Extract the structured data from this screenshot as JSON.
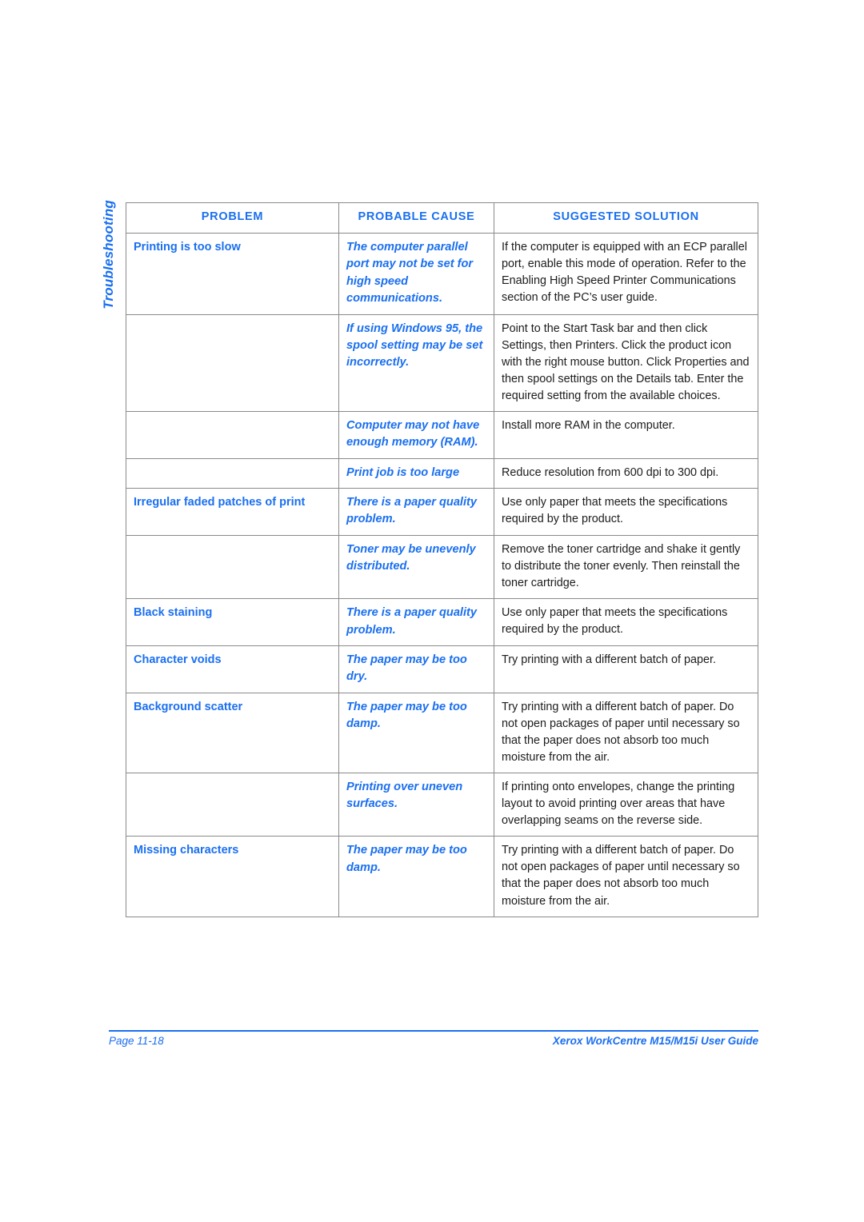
{
  "page": {
    "side_tab_label": "Troubleshooting",
    "accent_color": "#1a6ff0",
    "body_text_color": "#1c1c1c",
    "border_color": "#8a8a8a"
  },
  "table": {
    "headers": {
      "problem": "PROBLEM",
      "cause": "PROBABLE CAUSE",
      "solution": "SUGGESTED SOLUTION"
    },
    "rows": [
      {
        "problem": "Printing is too slow",
        "cause": "The computer parallel port may not be set for high speed communications.",
        "solution": "If the computer is equipped with an ECP parallel port, enable this mode of operation. Refer to the Enabling High Speed Printer Communications section of the PC’s user guide."
      },
      {
        "problem": "",
        "cause": "If using Windows 95, the spool setting may be set incorrectly.",
        "solution": "Point to the Start Task bar and then click Settings, then Printers. Click the product icon with the right mouse button. Click Properties and then spool settings on the Details tab. Enter the required setting from the available choices."
      },
      {
        "problem": "",
        "cause": "Computer may not have enough memory (RAM).",
        "solution": "Install more RAM in the computer."
      },
      {
        "problem": "",
        "cause": "Print job is too large",
        "solution": "Reduce resolution from 600 dpi to 300 dpi."
      },
      {
        "problem": "Irregular faded patches of print",
        "cause": "There is a paper quality problem.",
        "solution": "Use only paper that meets the specifications required by the product."
      },
      {
        "problem": "",
        "cause": "Toner may be unevenly distributed.",
        "solution": "Remove the toner cartridge and shake it gently to distribute the toner evenly. Then reinstall the toner cartridge."
      },
      {
        "problem": "Black staining",
        "cause": "There is a paper quality problem.",
        "solution": "Use only paper that meets the specifications required by the product."
      },
      {
        "problem": "Character voids",
        "cause": "The paper may be too dry.",
        "solution": "Try printing with a different batch of paper."
      },
      {
        "problem": "Background scatter",
        "cause": "The paper may be too damp.",
        "solution": "Try printing with a different batch of paper. Do not open packages of paper until necessary so that the paper does not absorb too much moisture from the air."
      },
      {
        "problem": "",
        "cause": "Printing over uneven surfaces.",
        "solution": "If printing onto envelopes, change the printing layout to avoid printing over areas that have overlapping seams on the reverse side."
      },
      {
        "problem": "Missing characters",
        "cause": "The paper may be too damp.",
        "solution": "Try printing with a different batch of paper. Do not open packages of paper until necessary so that the paper does not absorb too much moisture from the air."
      }
    ]
  },
  "footer": {
    "page_label": "Page 11-18",
    "guide_title": "Xerox WorkCentre M15/M15i User Guide"
  }
}
